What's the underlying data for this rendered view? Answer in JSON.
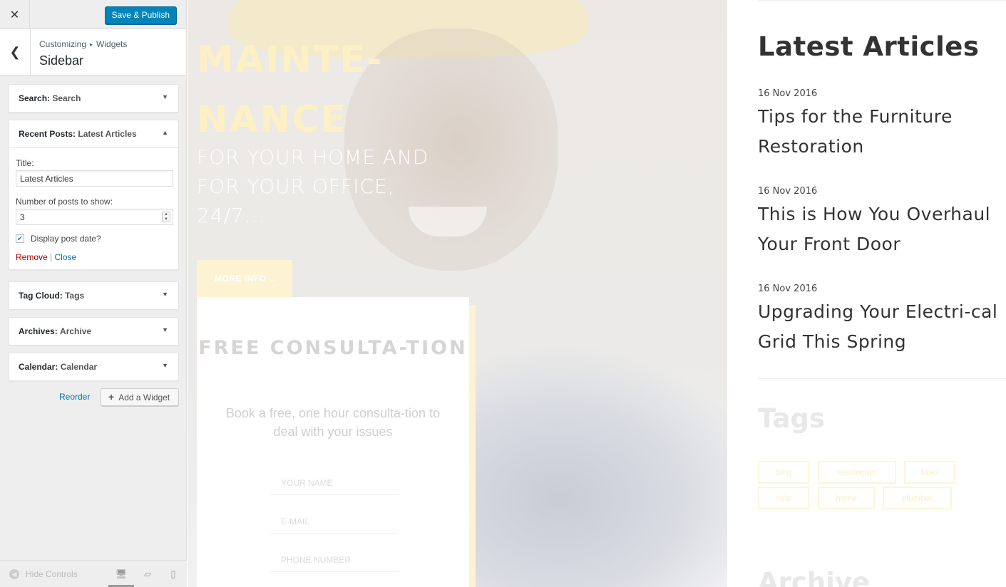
{
  "customizer": {
    "close_icon": "close-icon",
    "save_label": "Save & Publish",
    "breadcrumb": [
      "Customizing",
      "Widgets"
    ],
    "section_title": "Sidebar",
    "widgets": [
      {
        "type": "Search:",
        "title": "Search",
        "expanded": false
      },
      {
        "type": "Recent Posts:",
        "title": "Latest Articles",
        "expanded": true
      },
      {
        "type": "Tag Cloud:",
        "title": "Tags",
        "expanded": false
      },
      {
        "type": "Archives:",
        "title": "Archive",
        "expanded": false
      },
      {
        "type": "Calendar:",
        "title": "Calendar",
        "expanded": false
      }
    ],
    "recent_posts_form": {
      "title_label": "Title:",
      "title_value": "Latest Articles",
      "number_label": "Number of posts to show:",
      "number_value": "3",
      "display_date_label": "Display post date?",
      "display_date_checked": true,
      "remove_label": "Remove",
      "separator": "|",
      "close_label": "Close"
    },
    "reorder_label": "Reorder",
    "add_widget_label": "Add a Widget",
    "hide_controls_label": "Hide Controls",
    "devices": [
      "desktop",
      "tablet",
      "mobile"
    ],
    "active_device": "desktop"
  },
  "preview": {
    "hero": {
      "title_lines": [
        "MAINTE-",
        "NANCE"
      ],
      "subtitle": "FOR YOUR HOME AND FOR YOUR OFFICE, 24/7...",
      "button_label": "MORE INFO →"
    },
    "consultation": {
      "title": "FREE CONSULTA-TION",
      "text": "Book a free, one hour consulta-tion to deal with your issues",
      "fields": [
        "YOUR NAME",
        "E-MAIL",
        "PHONE NUMBER"
      ]
    },
    "sidebar": {
      "latest_title": "Latest Articles",
      "articles": [
        {
          "date": "16 Nov 2016",
          "title": "Tips for the Furniture Restoration"
        },
        {
          "date": "16 Nov 2016",
          "title": "This is How You Overhaul Your Front Door"
        },
        {
          "date": "16 Nov 2016",
          "title": "Upgrading Your Electri-cal Grid This Spring"
        }
      ],
      "tags_title": "Tags",
      "tags": [
        "blog",
        "electrician",
        "fixes",
        "help",
        "home",
        "plumber"
      ],
      "archive_title": "Archive"
    }
  },
  "colors": {
    "primary_button": "#0085ba",
    "accent_yellow": "#fdf0c4",
    "link": "#0073aa",
    "remove": "#aa0000"
  }
}
